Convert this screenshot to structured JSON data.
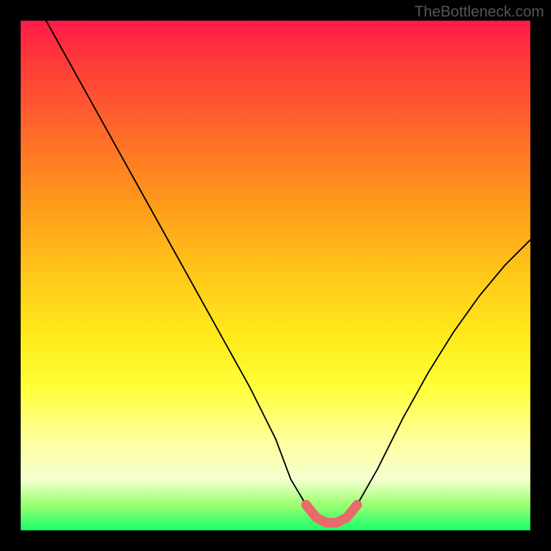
{
  "watermark": "TheBottleneck.com",
  "chart_data": {
    "type": "line",
    "title": "",
    "xlabel": "",
    "ylabel": "",
    "xlim": [
      0,
      100
    ],
    "ylim": [
      0,
      100
    ],
    "series": [
      {
        "name": "bottleneck-curve",
        "x": [
          5,
          10,
          15,
          20,
          25,
          30,
          35,
          40,
          45,
          50,
          53,
          56,
          58,
          60,
          62,
          64,
          66,
          70,
          75,
          80,
          85,
          90,
          95,
          100
        ],
        "y": [
          100,
          91,
          82,
          73,
          64,
          55,
          46,
          37,
          28,
          18,
          10,
          5,
          2.5,
          1.5,
          1.5,
          2.5,
          5,
          12,
          22,
          31,
          39,
          46,
          52,
          57
        ]
      },
      {
        "name": "highlight-band",
        "x": [
          56,
          58,
          60,
          62,
          64,
          66
        ],
        "y": [
          5,
          2.5,
          1.5,
          1.5,
          2.5,
          5
        ]
      }
    ],
    "gradient_stops": [
      {
        "pct": 0,
        "color": "#ff1a4a"
      },
      {
        "pct": 8,
        "color": "#ff3a3a"
      },
      {
        "pct": 22,
        "color": "#ff6a2a"
      },
      {
        "pct": 36,
        "color": "#ff9a1a"
      },
      {
        "pct": 50,
        "color": "#ffc81a"
      },
      {
        "pct": 62,
        "color": "#ffea1a"
      },
      {
        "pct": 72,
        "color": "#ffff3a"
      },
      {
        "pct": 82,
        "color": "#ffff9a"
      },
      {
        "pct": 90,
        "color": "#f5ffd0"
      },
      {
        "pct": 95,
        "color": "#9aff70"
      },
      {
        "pct": 100,
        "color": "#1aff6a"
      }
    ]
  }
}
